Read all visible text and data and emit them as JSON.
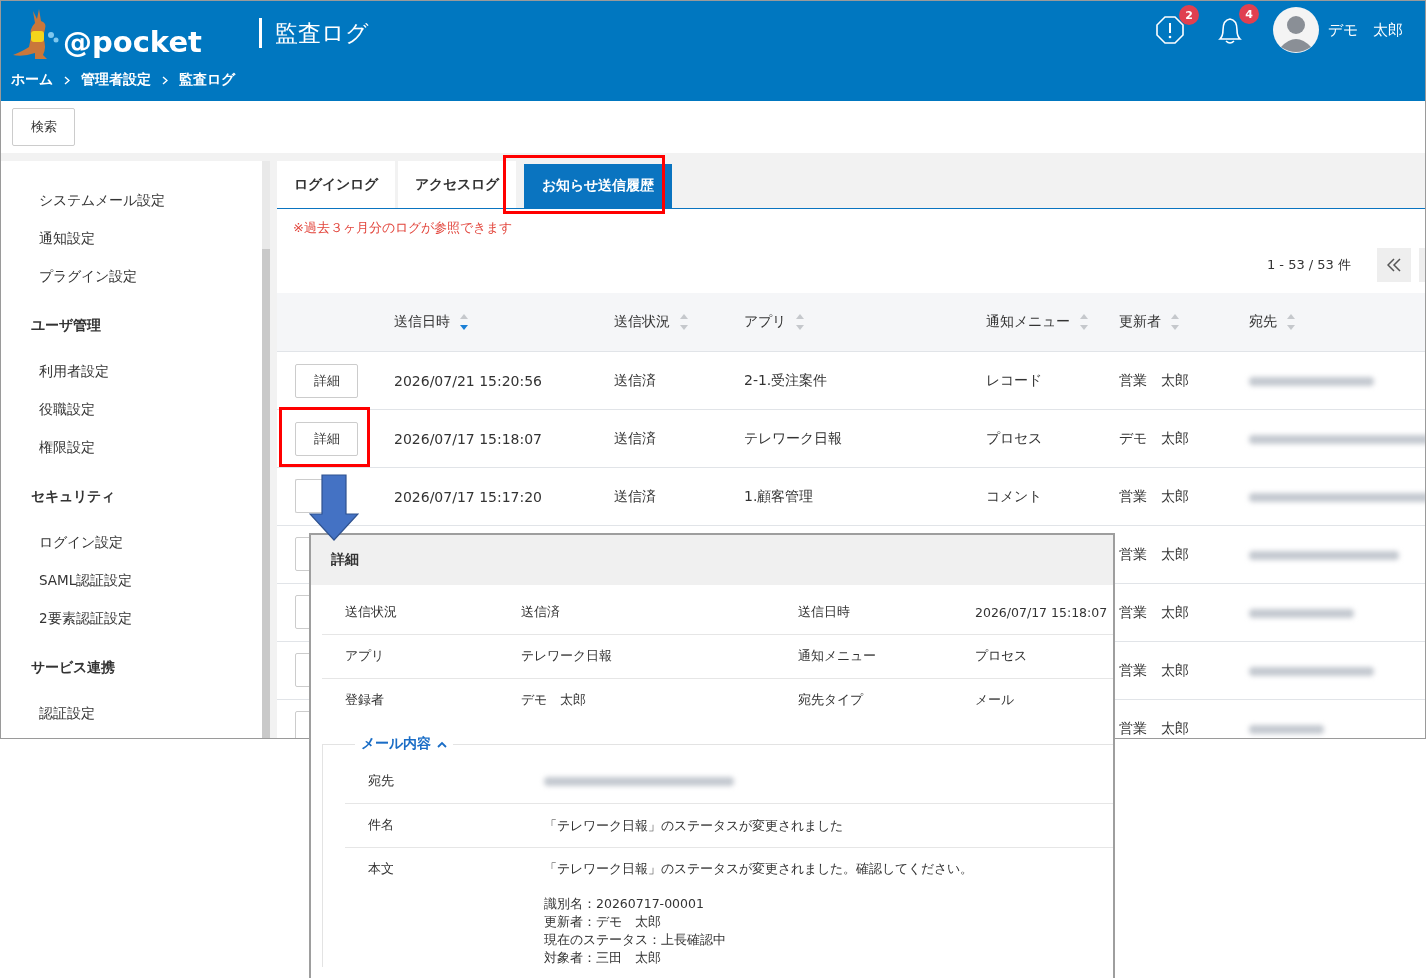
{
  "header": {
    "logo_text": "@pocket",
    "title": "監査ログ",
    "breadcrumb": [
      "ホーム",
      "管理者設定",
      "監査ログ"
    ],
    "alert_badge": "2",
    "notification_badge": "4",
    "user_name": "デモ　太郎"
  },
  "toolbar": {
    "search_button": "検索"
  },
  "sidebar": [
    {
      "kind": "item",
      "label": "システムメール設定"
    },
    {
      "kind": "item",
      "label": "通知設定"
    },
    {
      "kind": "item",
      "label": "プラグイン設定"
    },
    {
      "kind": "header",
      "label": "ユーザ管理"
    },
    {
      "kind": "item",
      "label": "利用者設定"
    },
    {
      "kind": "item",
      "label": "役職設定"
    },
    {
      "kind": "item",
      "label": "権限設定"
    },
    {
      "kind": "header",
      "label": "セキュリティ"
    },
    {
      "kind": "item",
      "label": "ログイン設定"
    },
    {
      "kind": "item",
      "label": "SAML認証設定"
    },
    {
      "kind": "item",
      "label": "2要素認証設定"
    },
    {
      "kind": "header",
      "label": "サービス連携"
    },
    {
      "kind": "item",
      "label": "認証設定"
    }
  ],
  "tabs": [
    {
      "label": "ログインログ",
      "selected": false
    },
    {
      "label": "アクセスログ",
      "selected": false
    },
    {
      "label": "お知らせ送信履歴",
      "selected": true
    }
  ],
  "notice": "※過去３ヶ月分のログが参照できます",
  "pagination": {
    "range": "1 - 53 / 53 件"
  },
  "table": {
    "columns": [
      {
        "label": "送信日時",
        "sorted": true
      },
      {
        "label": "送信状況",
        "sorted": false
      },
      {
        "label": "アプリ",
        "sorted": false
      },
      {
        "label": "通知メニュー",
        "sorted": false
      },
      {
        "label": "更新者",
        "sorted": false
      },
      {
        "label": "宛先",
        "sorted": false
      }
    ],
    "rows": [
      {
        "button": "詳細",
        "sent_at": "2026/07/21 15:20:56",
        "status": "送信済",
        "app": "2-1.受注案件",
        "menu": "レコード",
        "updater": "営業　太郎"
      },
      {
        "button": "詳細",
        "sent_at": "2026/07/17 15:18:07",
        "status": "送信済",
        "app": "テレワーク日報",
        "menu": "プロセス",
        "updater": "デモ　太郎"
      },
      {
        "sent_at": "2026/07/17 15:17:20",
        "status": "送信済",
        "app": "1.顧客管理",
        "menu": "コメント",
        "updater": "営業　太郎"
      },
      {
        "updater": "営業　太郎"
      },
      {
        "updater": "営業　太郎"
      },
      {
        "updater": "営業　太郎"
      },
      {
        "updater": "営業　太郎"
      }
    ]
  },
  "detail_popup": {
    "title": "詳細",
    "fields": [
      {
        "label": "送信状況",
        "value": "送信済"
      },
      {
        "label": "送信日時",
        "value": "2026/07/17 15:18:07"
      },
      {
        "label": "アプリ",
        "value": "テレワーク日報"
      },
      {
        "label": "通知メニュー",
        "value": "プロセス"
      },
      {
        "label": "登録者",
        "value": "デモ　太郎"
      },
      {
        "label": "宛先タイプ",
        "value": "メール"
      }
    ],
    "mail_section": {
      "title": "メール内容",
      "expanded": true,
      "rows": [
        {
          "kind": "blurred",
          "label": "宛先"
        },
        {
          "kind": "text",
          "label": "件名",
          "paragraphs": [
            [
              "「テレワーク日報」のステータスが変更されました"
            ]
          ]
        },
        {
          "kind": "text",
          "label": "本文",
          "paragraphs": [
            [
              "「テレワーク日報」のステータスが変更されました。確認してください。"
            ],
            [
              "識別名：20260717-00001",
              "更新者：デモ　太郎",
              "現在のステータス：上長確認中",
              "対象者：三田　太郎"
            ]
          ]
        }
      ]
    }
  }
}
